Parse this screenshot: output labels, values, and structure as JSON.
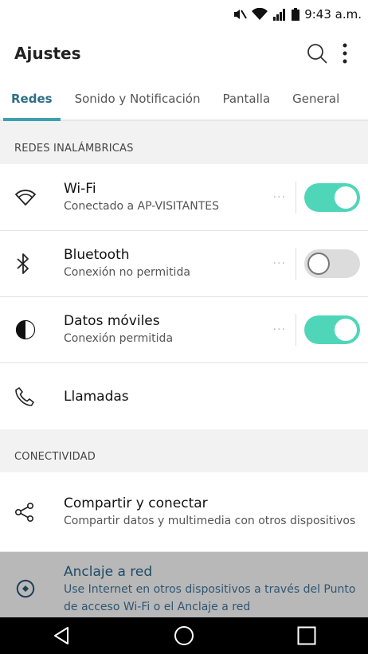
{
  "status_bar": {
    "time": "9:43 a.m."
  },
  "app_bar": {
    "title": "Ajustes"
  },
  "tabs": [
    {
      "label": "Redes",
      "active": true
    },
    {
      "label": "Sonido y Notificación",
      "active": false
    },
    {
      "label": "Pantalla",
      "active": false
    },
    {
      "label": "General",
      "active": false
    }
  ],
  "sections": {
    "wireless": {
      "header": "REDES INALÁMBRICAS",
      "items": [
        {
          "title": "Wi-Fi",
          "subtitle": "Conectado a AP-VISITANTES",
          "icon": "wifi-icon",
          "toggle": "on"
        },
        {
          "title": "Bluetooth",
          "subtitle": "Conexión no permitida",
          "icon": "bluetooth-icon",
          "toggle": "off"
        },
        {
          "title": "Datos móviles",
          "subtitle": "Conexión permitida",
          "icon": "mobile-data-icon",
          "toggle": "on"
        },
        {
          "title": "Llamadas",
          "icon": "phone-icon"
        }
      ]
    },
    "connectivity": {
      "header": "CONECTIVIDAD",
      "items": [
        {
          "title": "Compartir y conectar",
          "subtitle": "Compartir datos y multimedia con otros dispositivos",
          "icon": "share-icon"
        },
        {
          "title": "Anclaje a red",
          "subtitle": "Use Internet en otros dispositivos a través del Punto de acceso Wi-Fi o el Anclaje a red",
          "icon": "tethering-icon"
        }
      ]
    }
  },
  "colors": {
    "accent": "#3ba0b0",
    "toggle_on": "#4fd6b8",
    "toggle_off": "#dcdcdc"
  }
}
